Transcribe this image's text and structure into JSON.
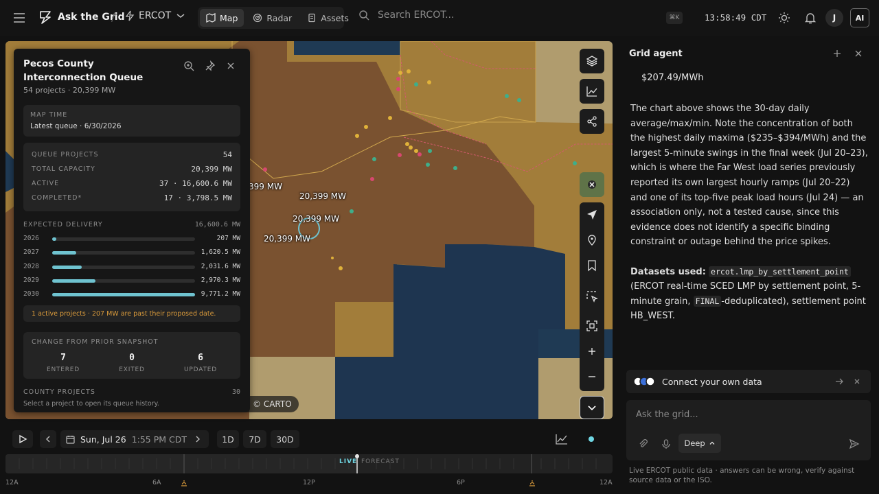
{
  "topbar": {
    "app_name": "Ask the Grid",
    "separator": "/",
    "iso": "ERCOT",
    "tabs": [
      {
        "label": "Map",
        "active": true
      },
      {
        "label": "Radar",
        "active": false
      },
      {
        "label": "Assets",
        "active": false
      }
    ],
    "search_placeholder": "Search ERCOT...",
    "shortcut": "⌘K",
    "clock": "13:58:49 CDT",
    "avatar_initial": "J",
    "ai_label": "AI"
  },
  "map": {
    "capacity_labels": [
      "399 MW",
      "20,399 MW",
      "20,399 MW",
      "20,399 MW"
    ],
    "attribution": "© CARTO",
    "colors": {
      "county": "#7a5230",
      "region": "#a27d3a",
      "water": "#1f3a54",
      "pale": "#b09c6e"
    }
  },
  "panel": {
    "title": "Pecos County Interconnection Queue",
    "subtitle": "54 projects · 20,399 MW",
    "map_time_label": "MAP TIME",
    "map_time_value": "Latest queue · 6/30/2026",
    "stats": [
      {
        "label": "QUEUE PROJECTS",
        "value": "54"
      },
      {
        "label": "TOTAL CAPACITY",
        "value": "20,399 MW"
      },
      {
        "label": "ACTIVE",
        "value": "37 · 16,600.6 MW"
      },
      {
        "label": "COMPLETED*",
        "value": "17 · 3,798.5 MW"
      }
    ],
    "delivery_label": "EXPECTED DELIVERY",
    "delivery_total": "16,600.6 MW",
    "delivery": [
      {
        "year": "2026",
        "value": "207 MW",
        "fraction": 0.021
      },
      {
        "year": "2027",
        "value": "1,620.5 MW",
        "fraction": 0.166
      },
      {
        "year": "2028",
        "value": "2,031.6 MW",
        "fraction": 0.208
      },
      {
        "year": "2029",
        "value": "2,970.3 MW",
        "fraction": 0.304
      },
      {
        "year": "2030",
        "value": "9,771.2 MW",
        "fraction": 1.0
      }
    ],
    "warning": "1 active projects · 207 MW are past their proposed date.",
    "change_label": "CHANGE FROM PRIOR SNAPSHOT",
    "changes": [
      {
        "num": "7",
        "label": "ENTERED"
      },
      {
        "num": "0",
        "label": "EXITED"
      },
      {
        "num": "6",
        "label": "UPDATED"
      }
    ],
    "county_label": "COUNTY PROJECTS",
    "county_count": "30",
    "county_hint": "Select a project to open its queue history."
  },
  "timeline": {
    "date": "Sun, Jul 26",
    "time": "1:55 PM CDT",
    "ranges": [
      "1D",
      "7D",
      "30D"
    ],
    "live": "LIVE",
    "forecast": "FORECAST",
    "ticks": [
      "12A",
      "6A",
      "12P",
      "6P",
      "12A"
    ]
  },
  "agent": {
    "title": "Grid agent",
    "price": "$207.49/MWh",
    "paragraph": "The chart above shows the 30-day daily average/max/min. Note the concentration of both the highest daily maxima ($235–$394/MWh) and the largest 5-minute swings in the final week (Jul 20–23), which is where the Far West load series previously reported its own largest hourly ramps (Jul 20–22) and one of its top-five peak load hours (Jul 24) — an association only, not a tested cause, since this evidence does not identify a specific binding constraint or outage behind the price spikes.",
    "datasets_label": "Datasets used:",
    "dataset_code": "ercot.lmp_by_settlement_point",
    "dataset_desc_a": "(ERCOT real-time SCED LMP by settlement point, 5-minute grain,",
    "dataset_code2": "FINAL",
    "dataset_desc_b": "-deduplicated), settlement point HB_WEST.",
    "connect": "Connect your own data",
    "ask_placeholder": "Ask the grid...",
    "mode": "Deep",
    "disclaimer": "Live ERCOT public data · answers can be wrong, verify against source data or the ISO."
  }
}
